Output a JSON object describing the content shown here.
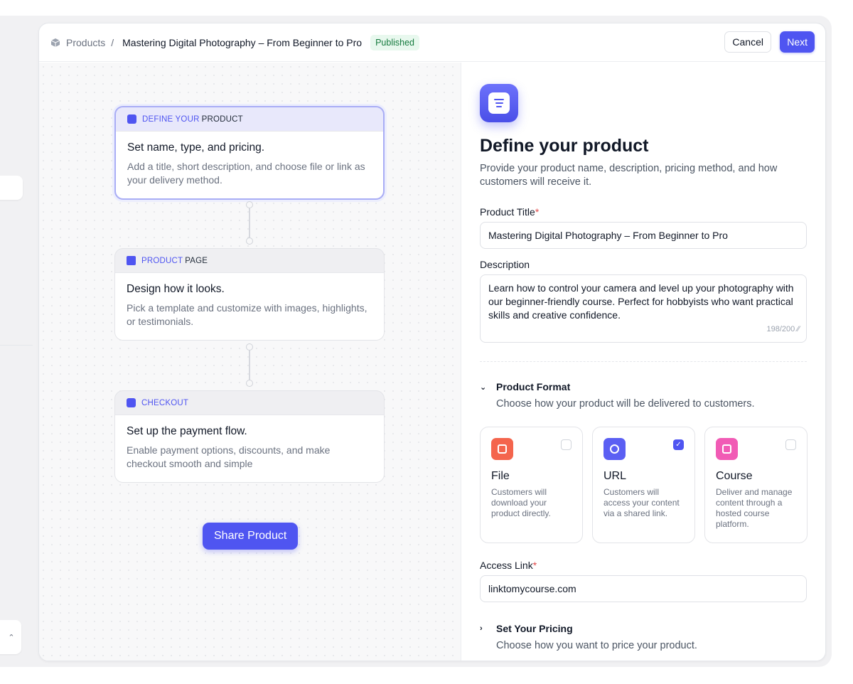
{
  "breadcrumb": {
    "root": "Products",
    "separator": "/",
    "current": "Mastering Digital Photography – From Beginner to Pro",
    "status": "Published"
  },
  "actions": {
    "cancel": "Cancel",
    "next": "Next"
  },
  "steps": [
    {
      "keyword": "DEFINE YOUR",
      "rest": "PRODUCT",
      "title": "Set name, type, and pricing.",
      "desc": "Add a title, short description, and choose file or link as your delivery method.",
      "active": true
    },
    {
      "keyword": "PRODUCT",
      "rest": "PAGE",
      "title": "Design how it looks.",
      "desc": "Pick a template and customize with images, highlights, or testimonials.",
      "active": false
    },
    {
      "keyword": "CHECKOUT",
      "rest": "",
      "title": "Set up the payment flow.",
      "desc": "Enable payment options, discounts, and make checkout smooth and simple",
      "active": false
    }
  ],
  "share_button": "Share Product",
  "panel": {
    "title": "Define your product",
    "subtitle": "Provide your product name, description, pricing method, and how customers will receive it.",
    "product_title_label": "Product Title",
    "required_mark": "*",
    "product_title_value": "Mastering Digital Photography – From Beginner to Pro",
    "description_label": "Description",
    "description_value": "Learn how to control your camera and level up your photography with our beginner-friendly course. Perfect for hobbyists who want practical skills and creative confidence.",
    "description_counter": "198/200",
    "format_heading": "Product Format",
    "format_sub": "Choose how your product will be delivered to customers.",
    "formats": [
      {
        "title": "File",
        "desc": "Customers will download your product directly.",
        "checked": false,
        "color": "#f4654d"
      },
      {
        "title": "URL",
        "desc": "Customers will access your content via a shared link.",
        "checked": true,
        "color": "#5b5ff3"
      },
      {
        "title": "Course",
        "desc": "Deliver and manage content through a hosted course platform.",
        "checked": false,
        "color": "#f15bb5"
      }
    ],
    "access_label": "Access Link",
    "access_value": "linktomycourse.com",
    "pricing_heading": "Set Your Pricing",
    "pricing_sub": "Choose how you want to price your product."
  }
}
